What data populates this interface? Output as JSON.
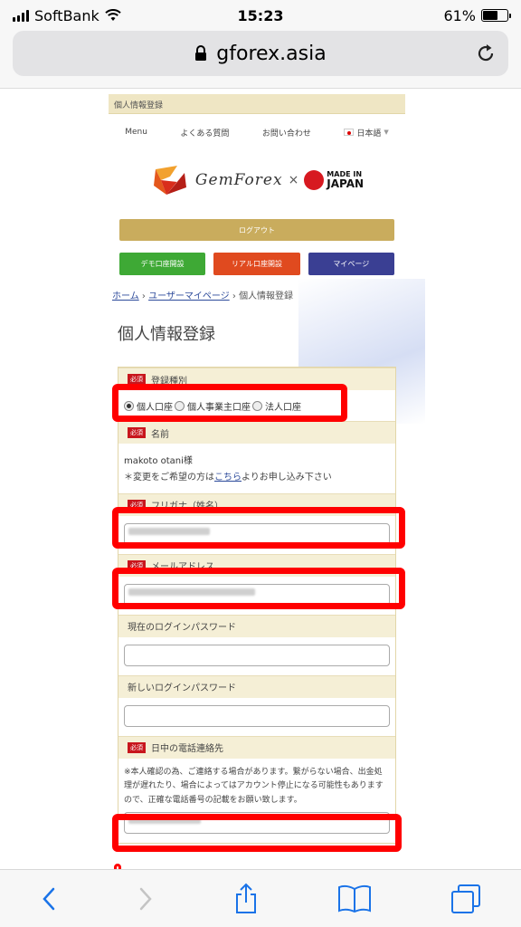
{
  "status_bar": {
    "carrier": "SoftBank",
    "time": "15:23",
    "battery": "61%"
  },
  "browser": {
    "url": "gforex.asia"
  },
  "site": {
    "top_strip": "個人情報登録",
    "nav": [
      "Menu",
      "よくある質問",
      "お問い合わせ",
      "日本語"
    ],
    "logo_text": "GemForex",
    "logo_x": "×",
    "made_in_line1": "MADE IN",
    "made_in_line2": "JAPAN",
    "logout": "ログアウト",
    "buttons": {
      "demo": "デモ口座開設",
      "real": "リアル口座開設",
      "mypage": "マイページ"
    },
    "breadcrumb": {
      "home": "ホーム",
      "sep": "›",
      "user_page": "ユーザーマイページ",
      "current": "個人情報登録"
    },
    "heading": "個人情報登録"
  },
  "form": {
    "required_badge": "必須",
    "registration_type": {
      "label": "登録種別",
      "options": [
        "個人口座",
        "個人事業主口座",
        "法人口座"
      ]
    },
    "name": {
      "label": "名前",
      "value": "makoto otani様",
      "note_prefix": "＊変更をご希望の方は",
      "note_link": "こちら",
      "note_suffix": "よりお申し込み下さい"
    },
    "furigana": {
      "label": "フリガナ（姓名）"
    },
    "email": {
      "label": "メールアドレス"
    },
    "current_password": {
      "label": "現在のログインパスワード"
    },
    "new_password": {
      "label": "新しいログインパスワード"
    },
    "phone": {
      "label": "日中の電話連絡先",
      "note": "※本人確認の為、ご連絡する場合があります。繋がらない場合、出金処理が遅れたり、場合によってはアカウント停止になる可能性もありますので、正確な電話番号の記載をお願い致します。"
    }
  },
  "colors": {
    "highlight": "#ff0000",
    "required": "#c8161d",
    "gold": "#c9ac5d",
    "demo": "#3ea935",
    "real": "#e04a1f",
    "mypage": "#3a3f93"
  },
  "toolbar_icons": [
    "back-icon",
    "forward-icon",
    "share-icon",
    "bookmarks-icon",
    "tabs-icon"
  ]
}
